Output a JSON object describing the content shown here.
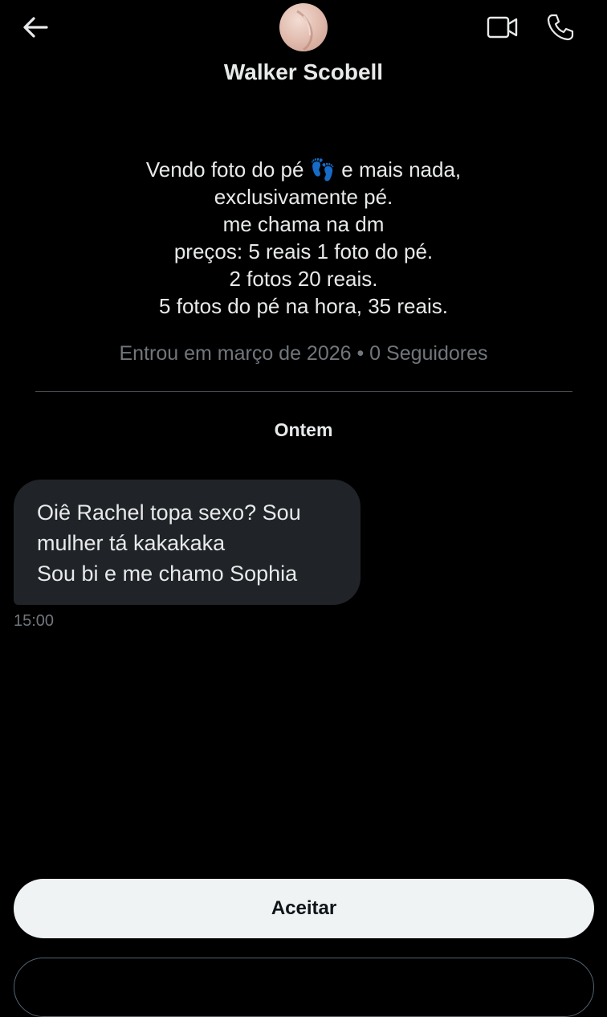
{
  "header": {
    "display_name": "Walker Scobell",
    "back_icon": "arrow-left-icon",
    "video_icon": "video-camera-icon",
    "phone_icon": "phone-icon"
  },
  "profile": {
    "bio_lines": [
      "Vendo foto do pé 👣 e mais nada,",
      "exclusivamente pé.",
      "me chama na dm",
      "preços: 5 reais 1 foto do pé.",
      "2 fotos 20 reais.",
      "5 fotos do pé na hora, 35 reais."
    ],
    "meta": "Entrou em março de 2026 • 0 Seguidores"
  },
  "conversation": {
    "date_separator": "Ontem",
    "message": {
      "lines": [
        "Oiê Rachel topa sexo? Sou",
        "mulher tá kakakaka",
        "Sou bi e me chamo Sophia"
      ],
      "time": "15:00"
    }
  },
  "actions": {
    "accept_label": "Aceitar"
  },
  "colors": {
    "background": "#000000",
    "text_primary": "#e7e9ea",
    "text_secondary": "#71767b",
    "bubble_bg": "#202327",
    "button_bg": "#eff3f4",
    "button_text": "#0f1419"
  }
}
